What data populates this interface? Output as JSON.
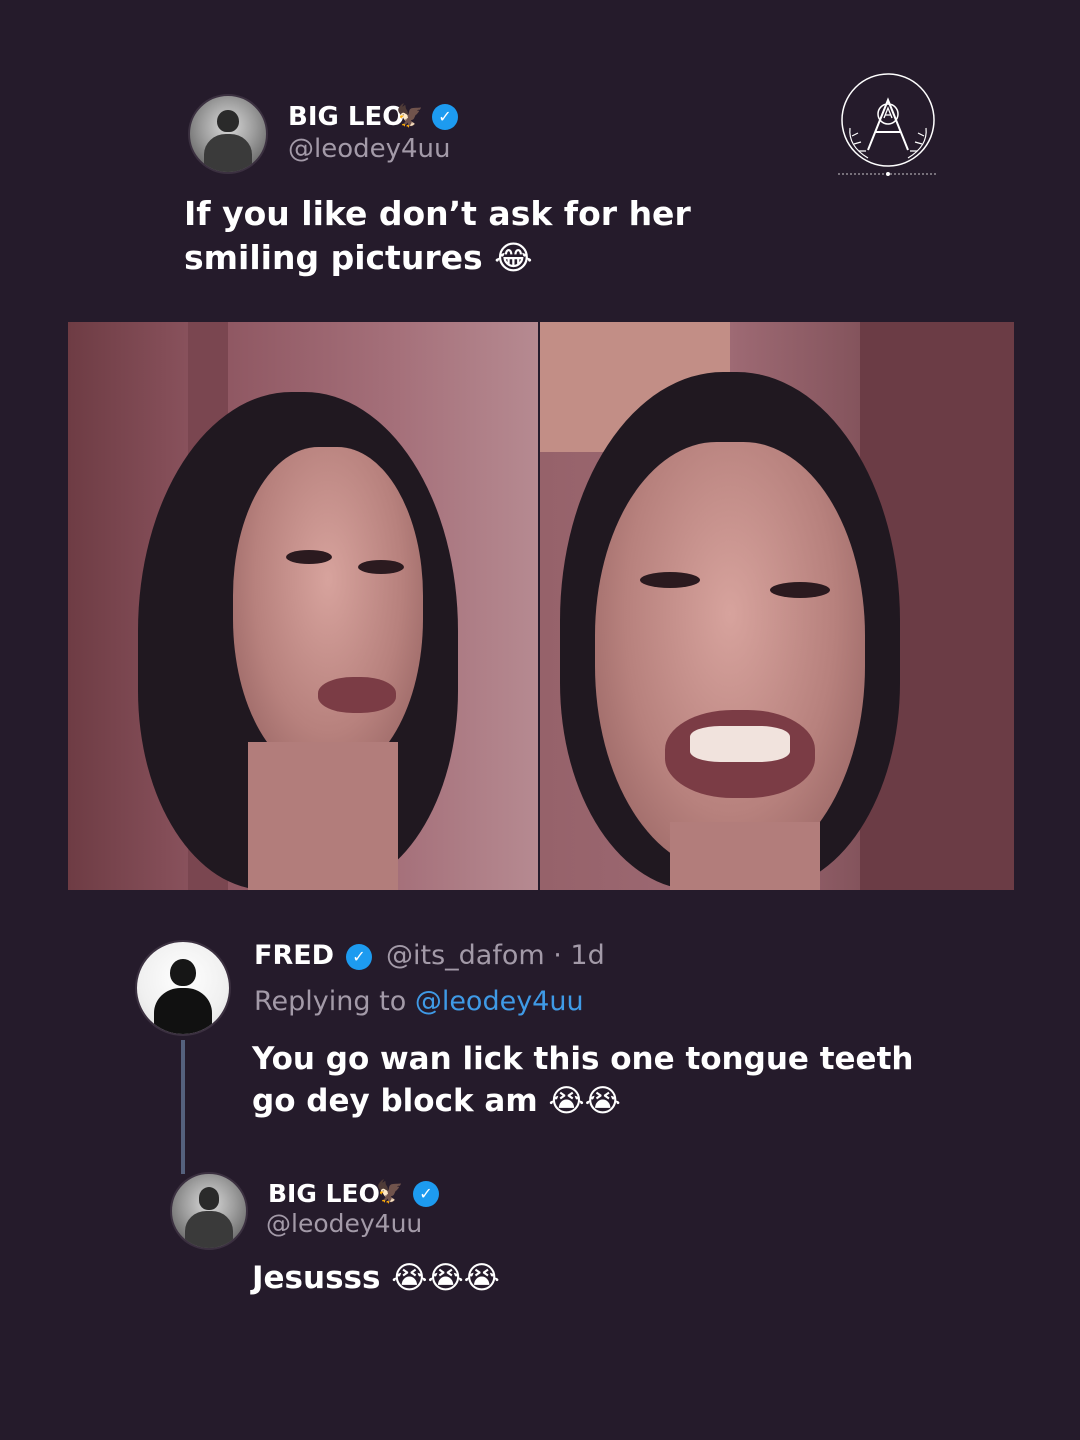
{
  "main_tweet": {
    "author_name": "BIG LEO",
    "author_emoji": "🦅",
    "handle": "@leodey4uu",
    "text": "If you like don’t ask for her smiling pictures 😂"
  },
  "reply": {
    "author_name": "FRED",
    "handle_and_time": "@its_dafom · 1d",
    "replying_prefix": "Replying to ",
    "replying_handle": "@leodey4uu",
    "text": "You go wan lick this one tongue teeth go dey block am 😭😭"
  },
  "nested_reply": {
    "author_name": "BIG LEO",
    "author_emoji": "🦅",
    "handle": "@leodey4uu",
    "text": "Jesusss 😭😭😭"
  },
  "colors": {
    "background": "#251b2b",
    "verified": "#1d9bf0",
    "link": "#3f9ae6",
    "handle": "#a39aa8",
    "thread_line": "#55617d"
  }
}
